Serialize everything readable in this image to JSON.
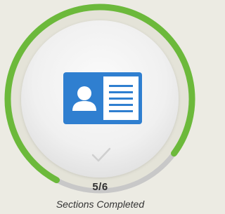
{
  "progress": {
    "completed": 5,
    "total": 6,
    "count_text": "5/6",
    "caption": "Sections Completed",
    "fraction_complete": 0.8333
  },
  "icons": {
    "section": "id-card-icon",
    "status": "checkmark-icon"
  },
  "colors": {
    "background": "#ecebe3",
    "ring_complete": "#6cb93b",
    "ring_remaining": "#c8c8c8",
    "inner_disc": "#f1f1f1",
    "card_blue": "#2f7fd0",
    "check_gray": "#cfcfcf"
  }
}
